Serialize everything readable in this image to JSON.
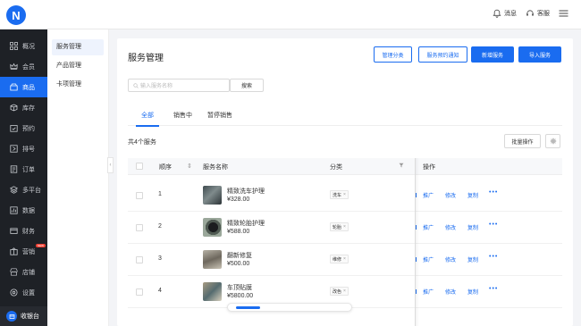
{
  "topbar": {
    "logo_letter": "N",
    "messages_label": "消息",
    "support_label": "客服"
  },
  "sidebar": {
    "items": [
      {
        "label": "概况",
        "icon": "grid-icon"
      },
      {
        "label": "会员",
        "icon": "crown-icon"
      },
      {
        "label": "商品",
        "icon": "shop-icon",
        "active": true
      },
      {
        "label": "库存",
        "icon": "box-icon"
      },
      {
        "label": "预约",
        "icon": "check-calendar-icon"
      },
      {
        "label": "排号",
        "icon": "queue-icon"
      },
      {
        "label": "订单",
        "icon": "order-icon"
      },
      {
        "label": "多平台",
        "icon": "layers-icon"
      },
      {
        "label": "数据",
        "icon": "chart-icon"
      },
      {
        "label": "财务",
        "icon": "finance-icon"
      },
      {
        "label": "营销",
        "icon": "marketing-icon",
        "badge": "NEW"
      },
      {
        "label": "店铺",
        "icon": "store-icon"
      },
      {
        "label": "设置",
        "icon": "settings-icon"
      }
    ],
    "cashier_label": "收银台"
  },
  "subnav": {
    "items": [
      {
        "label": "服务管理",
        "active": true
      },
      {
        "label": "产品管理"
      },
      {
        "label": "卡项管理"
      }
    ]
  },
  "main": {
    "title": "服务管理",
    "buttons": {
      "category": "管理分类",
      "reserve_notice": "服务预约通知",
      "add": "新增服务",
      "import": "导入服务"
    },
    "search": {
      "placeholder": "输入服务名称",
      "button": "搜索"
    },
    "tabs": [
      "全部",
      "销售中",
      "暂停销售"
    ],
    "count_text": "共4个服务",
    "batch_label": "批量操作",
    "columns": {
      "order": "顺序",
      "name": "服务名称",
      "category": "分类",
      "actions": "操作"
    },
    "rows": [
      {
        "order": "1",
        "name": "精致洗车护理",
        "price": "¥328.00",
        "tag": "洗车"
      },
      {
        "order": "2",
        "name": "精致轮胎护理",
        "price": "¥588.00",
        "tag": "轮胎"
      },
      {
        "order": "3",
        "name": "翻新修复",
        "price": "¥500.00",
        "tag": "维修"
      },
      {
        "order": "4",
        "name": "车顶贴膜",
        "price": "¥5800.00",
        "tag": "改色"
      }
    ],
    "row_actions": {
      "promote": "推广",
      "edit": "修改",
      "copy": "复制",
      "more": "•••"
    }
  }
}
